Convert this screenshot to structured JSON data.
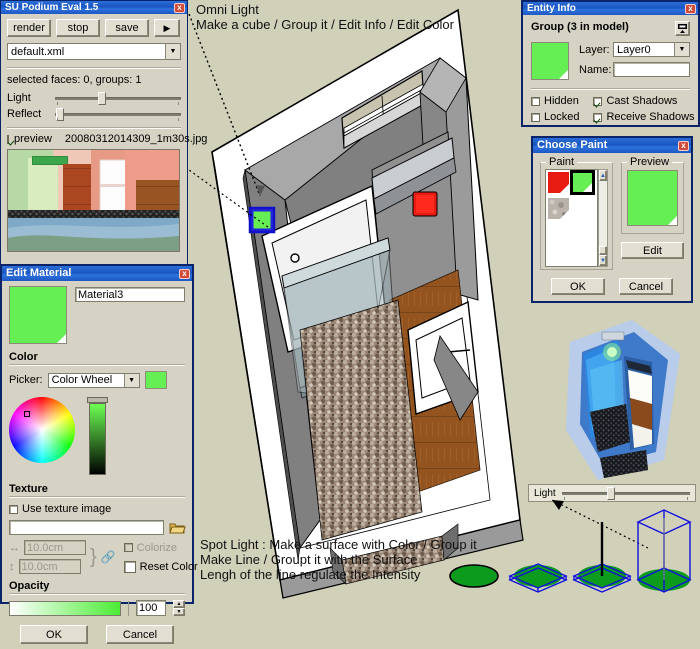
{
  "background_color": "#d1d0b9",
  "accent_green": "#66ee55",
  "titlebar_blue": "#1a55c0",
  "podium": {
    "title": "SU Podium Eval 1.5",
    "close_label": "x",
    "buttons": [
      "render",
      "stop",
      "save"
    ],
    "play_label": "▶",
    "preset": "default.xml",
    "status": "selected faces: 0, groups: 1",
    "light_label": "Light",
    "reflect_label": "Reflect",
    "light_value": 35,
    "reflect_value": 2,
    "preview_label": "preview",
    "preview_checked": true,
    "preview_filename": "20080312014309_1m30s.jpg"
  },
  "edit_material": {
    "title": "Edit Material",
    "close_label": "x",
    "material_name": "Material3",
    "color_section": "Color",
    "picker_label": "Picker:",
    "picker_value": "Color Wheel",
    "texture_section": "Texture",
    "use_texture_label": "Use texture image",
    "use_texture_checked": false,
    "texture_path": "",
    "width_value": "10.0cm",
    "height_value": "10.0cm",
    "colorize_label": "Colorize",
    "colorize_checked": false,
    "reset_color_label": "Reset Color",
    "reset_color_checked": false,
    "opacity_section": "Opacity",
    "opacity_value": "100",
    "ok_label": "OK",
    "cancel_label": "Cancel"
  },
  "entity_info": {
    "title": "Entity Info",
    "close_label": "x",
    "heading": "Group (3 in model)",
    "layer_label": "Layer:",
    "layer_value": "Layer0",
    "name_label": "Name:",
    "name_value": "",
    "hidden_label": "Hidden",
    "hidden_checked": false,
    "locked_label": "Locked",
    "locked_checked": false,
    "cast_shadows_label": "Cast Shadows",
    "cast_shadows_checked": true,
    "receive_shadows_label": "Receive Shadows",
    "receive_shadows_checked": true
  },
  "choose_paint": {
    "title": "Choose Paint",
    "close_label": "x",
    "paint_group": "Paint",
    "preview_group": "Preview",
    "edit_label": "Edit",
    "ok_label": "OK",
    "cancel_label": "Cancel",
    "swatches": [
      "#e81b12",
      "#66ee55",
      "#b9b3ac"
    ],
    "selected_index": 1,
    "preview_color": "#66ee55"
  },
  "light_slider": {
    "label": "Light",
    "value": 35
  },
  "annotations": {
    "top_line1": "Omni Light",
    "top_line2": "Make a cube / Group it / Edit Info / Edit Color",
    "bottom_line1": "Spot Light : Make a surface with Color / Group it",
    "bottom_line2": "Make Line / Groupt it with the Surface",
    "bottom_line3": "Lengh of the line regulate the Intensity"
  }
}
